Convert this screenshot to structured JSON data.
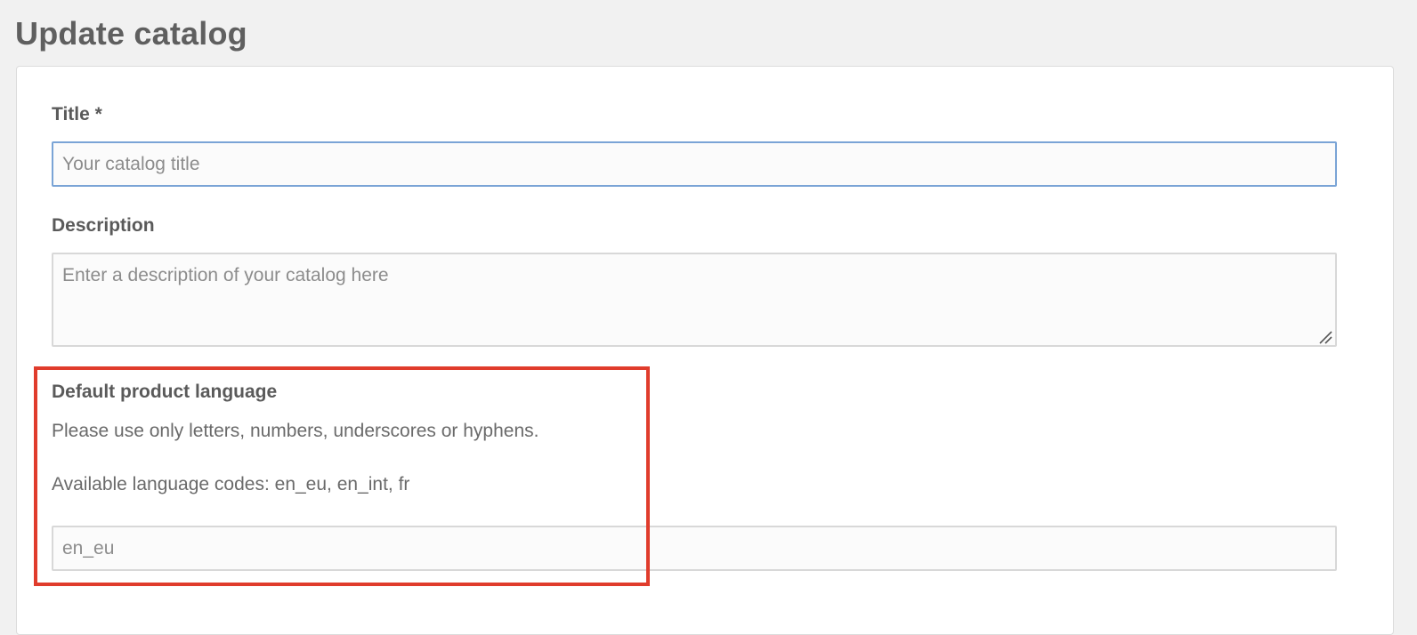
{
  "page": {
    "title": "Update catalog"
  },
  "form": {
    "title_field": {
      "label": "Title *",
      "value": "",
      "placeholder": "Your catalog title"
    },
    "description_field": {
      "label": "Description",
      "value": "",
      "placeholder": "Enter a description of your catalog here"
    },
    "language_field": {
      "label": "Default product language",
      "help_line_1": "Please use only letters, numbers, underscores or hyphens.",
      "help_line_2": "Available language codes: en_eu, en_int, fr",
      "value": "",
      "placeholder": "en_eu"
    }
  },
  "colors": {
    "background": "#f1f1f1",
    "card": "#ffffff",
    "focus_border": "#7aa4d6",
    "highlight": "#e03c2c"
  }
}
